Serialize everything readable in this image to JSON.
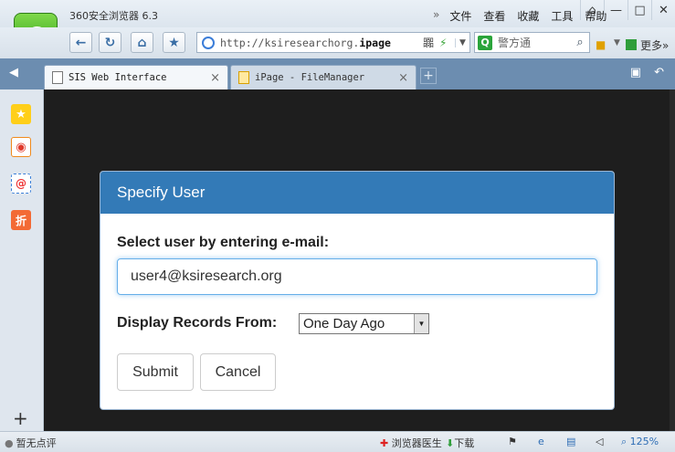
{
  "browser": {
    "app_title": "360安全浏览器 6.3",
    "menu_overflow": "»",
    "menu": [
      "文件",
      "查看",
      "收藏",
      "工具",
      "帮助"
    ],
    "window_controls": [
      "⌂",
      "—",
      "□",
      "✕"
    ],
    "logo_letter": "e"
  },
  "navbar": {
    "back": "←",
    "refresh": "↻",
    "home": "⌂",
    "favorite": "★",
    "url_plain": "http://ksiresearchorg.",
    "url_bold": "ipage",
    "url_extra": "嚻",
    "search_engine_letter": "Q",
    "search_text": "警方通",
    "more_label": "更多",
    "more_arrows": "»"
  },
  "tabs": [
    {
      "label": "SIS Web Interface",
      "active": true
    },
    {
      "label": "iPage - FileManager",
      "active": false
    }
  ],
  "tab_close": "×",
  "tab_new": "+",
  "sidebar": {
    "sale_label": "折",
    "add": "+"
  },
  "dialog": {
    "title": "Specify User",
    "email_label": "Select user by entering e-mail:",
    "email_value": "user4@ksiresearch.org",
    "display_label": "Display Records From:",
    "display_value": "One Day Ago",
    "submit_label": "Submit",
    "cancel_label": "Cancel"
  },
  "statusbar": {
    "left": "暂无点评",
    "doctor": "浏览器医生",
    "download": "下载",
    "zoom": "125%"
  },
  "colors": {
    "dialog_header": "#337ab7",
    "content_bg": "#1e1e1e",
    "tabbar": "#6c8db0"
  }
}
